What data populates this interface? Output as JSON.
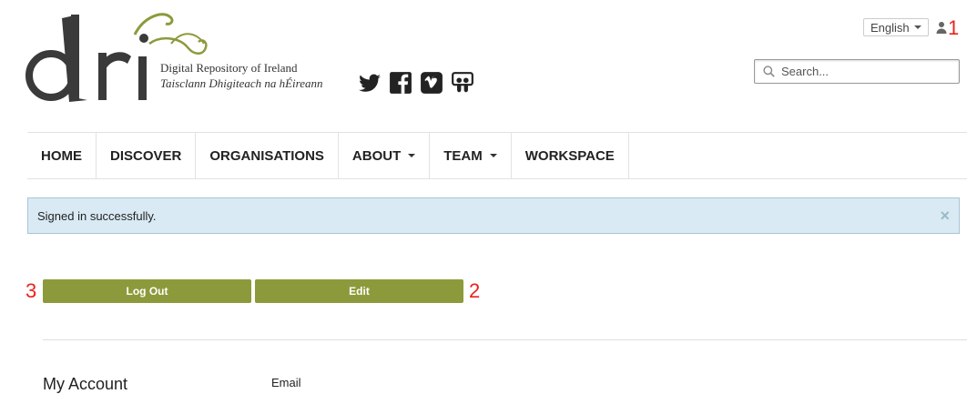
{
  "header": {
    "logo": {
      "wordmark": "dri",
      "line1": "Digital Repository of Ireland",
      "line2": "Taisclann Dhigiteach na hÉireann",
      "accent_color": "#8d9a3b"
    },
    "social_icons": [
      "twitter-icon",
      "facebook-icon",
      "vimeo-icon",
      "slideshare-icon"
    ],
    "language": {
      "selected": "English"
    },
    "user_icon": "user-icon",
    "search": {
      "placeholder": "Search..."
    }
  },
  "annotations": {
    "a1": "1",
    "a2": "2",
    "a3": "3",
    "color": "#e8231c"
  },
  "nav": {
    "items": [
      {
        "label": "HOME",
        "dropdown": false
      },
      {
        "label": "DISCOVER",
        "dropdown": false
      },
      {
        "label": "ORGANISATIONS",
        "dropdown": false
      },
      {
        "label": "ABOUT",
        "dropdown": true
      },
      {
        "label": "TEAM",
        "dropdown": true
      },
      {
        "label": "WORKSPACE",
        "dropdown": false
      }
    ]
  },
  "alert": {
    "message": "Signed in successfully.",
    "close": "×"
  },
  "actions": {
    "logout_label": "Log Out",
    "edit_label": "Edit",
    "button_color": "#8d9a3b"
  },
  "account": {
    "heading": "My Account",
    "email_label": "Email",
    "email_value": ""
  }
}
